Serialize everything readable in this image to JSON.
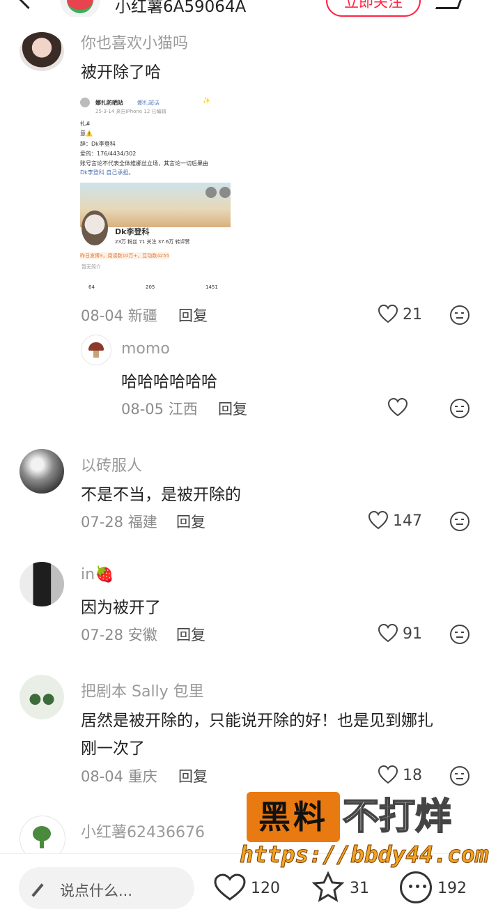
{
  "header": {
    "title": "小红薯6A59064A",
    "follow_label": "立即关注"
  },
  "comments": [
    {
      "username": "你也喜欢小猫吗",
      "text": "被开除了哈",
      "date": "08-04",
      "location": "新疆",
      "reply_label": "回复",
      "likes": "21",
      "image": {
        "account": "娜扎防晒站",
        "account_badge": "娜扎超话",
        "date_line": "25-3-14 来自iPhone 12 已编辑",
        "line1": "扎#",
        "line2": "意⚠️",
        "line3": "辞：Dk李登科",
        "line4": "爱的：176/4434/302",
        "line5": "账号言论不代表全体维娜丝立场，其言论一切后果由",
        "line6": "Dk李登科 自己承担。",
        "profile_name": "Dk李登科",
        "stats": "23万 粉丝    71 关注    37.6万 转评赞",
        "activity": "昨日发博3，阅读数10万+，互动数4255",
        "bio": "暂无简介",
        "reposts": "64",
        "comments": "205",
        "likes": "1451"
      },
      "replies": [
        {
          "username": "momo",
          "text": "哈哈哈哈哈哈",
          "date": "08-05",
          "location": "江西",
          "reply_label": "回复"
        }
      ]
    },
    {
      "username": "以砖服人",
      "text": "不是不当，是被开除的",
      "date": "07-28",
      "location": "福建",
      "reply_label": "回复",
      "likes": "147"
    },
    {
      "username": "in🍓",
      "text": "因为被开了",
      "date": "07-28",
      "location": "安徽",
      "reply_label": "回复",
      "likes": "91"
    },
    {
      "username": "把剧本 Sally 包里",
      "text_line1": "居然是被开除的，只能说开除的好！也是见到娜扎",
      "text_line2": "刚一次了",
      "date": "08-04",
      "location": "重庆",
      "reply_label": "回复",
      "likes": "18"
    },
    {
      "username": "小红薯62436676",
      "text": "…"
    }
  ],
  "watermark": {
    "box": "黑料",
    "text": "不打烊",
    "url": "https://bbdy44.com"
  },
  "bottom_bar": {
    "input_placeholder": "说点什么...",
    "likes": "120",
    "stars": "31",
    "comments": "192"
  },
  "colors": {
    "accent": "#ff2442",
    "watermark_orange": "#e97a12"
  }
}
